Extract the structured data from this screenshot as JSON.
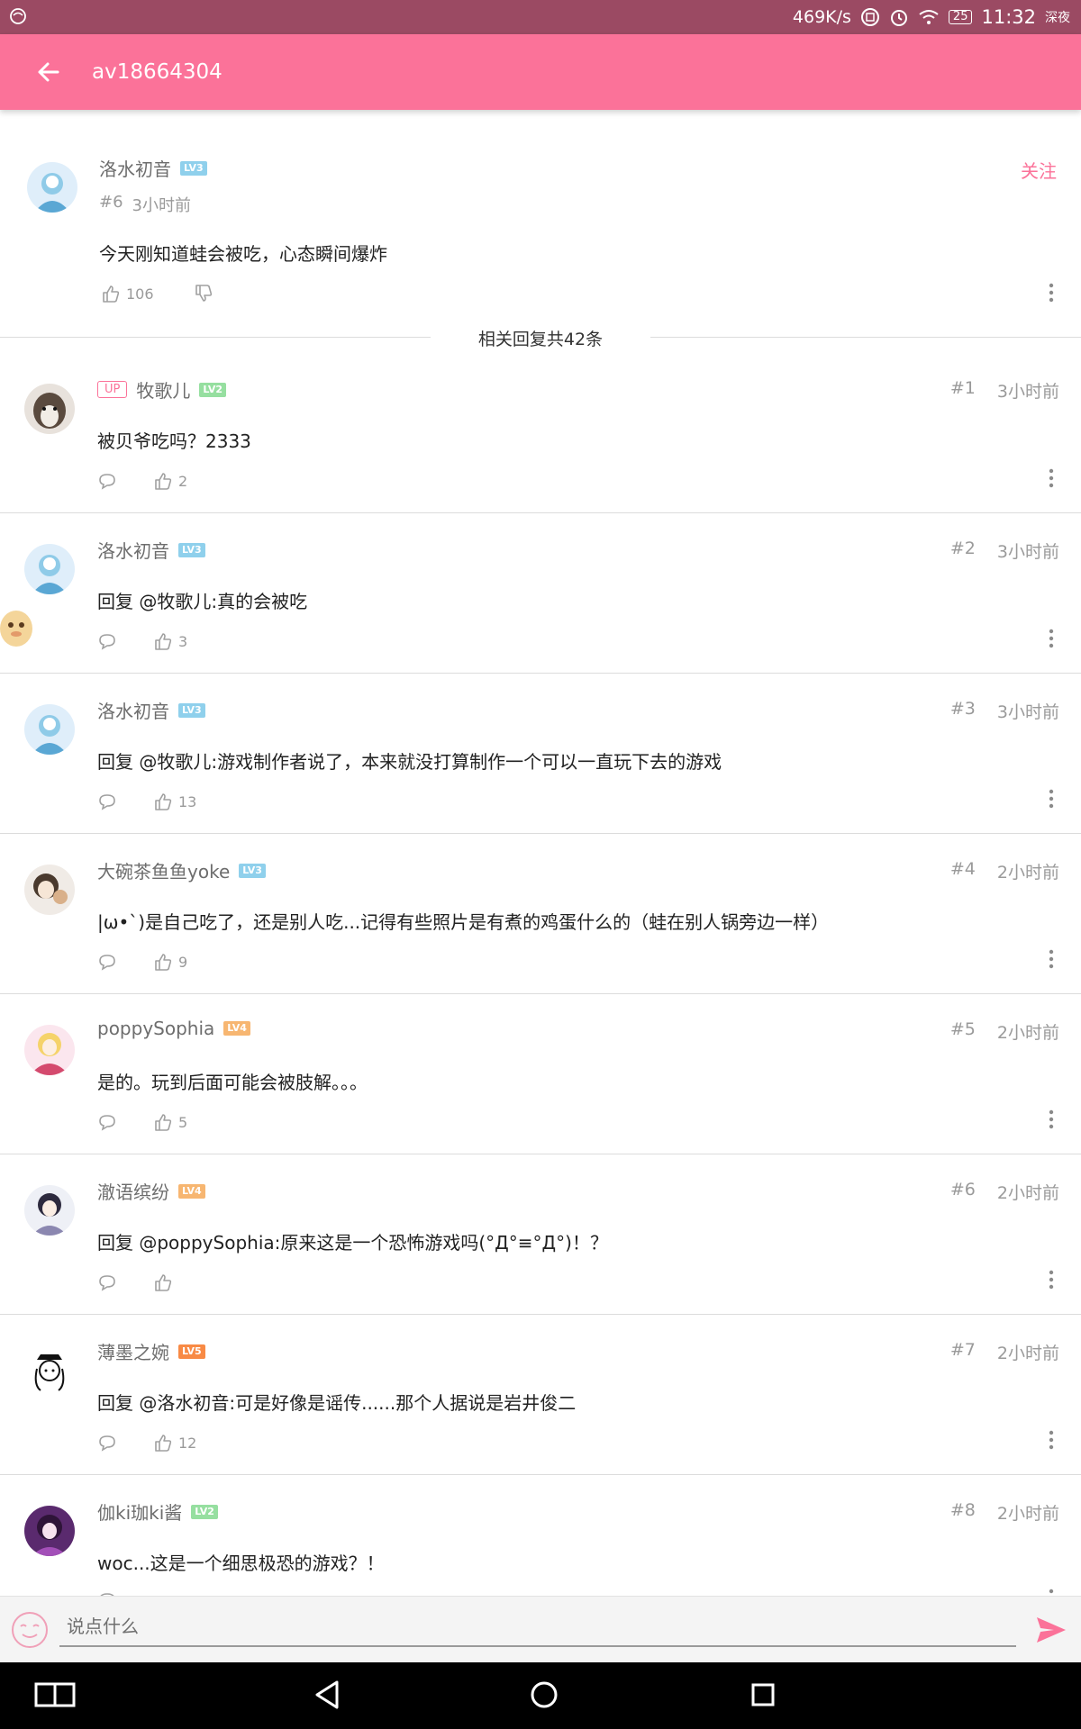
{
  "status_bar": {
    "speed": "469K/s",
    "battery": "25",
    "time": "11:32",
    "mode": "深夜"
  },
  "app_bar": {
    "title": "av18664304"
  },
  "main_comment": {
    "user": "洛水初音",
    "level": "LV3",
    "floor": "#6",
    "time": "3小时前",
    "text": "今天刚知道蛙会被吃，心态瞬间爆炸",
    "likes": "106",
    "follow_label": "关注"
  },
  "replies_header": "相关回复共42条",
  "replies": [
    {
      "user": "牧歌儿",
      "up_badge": "UP",
      "level": "LV2",
      "floor": "#1",
      "time": "3小时前",
      "text": "被贝爷吃吗？2333",
      "likes": "2"
    },
    {
      "user": "洛水初音",
      "level": "LV3",
      "floor": "#2",
      "time": "3小时前",
      "text": "回复 @牧歌儿:真的会被吃",
      "likes": "3"
    },
    {
      "user": "洛水初音",
      "level": "LV3",
      "floor": "#3",
      "time": "3小时前",
      "text": "回复 @牧歌儿:游戏制作者说了，本来就没打算制作一个可以一直玩下去的游戏",
      "likes": "13"
    },
    {
      "user": "大碗茶鱼鱼yoke",
      "level": "LV3",
      "floor": "#4",
      "time": "2小时前",
      "text": "|ω•`)是自己吃了，还是别人吃...记得有些照片是有煮的鸡蛋什么的（蛙在别人锅旁边一样）",
      "likes": "9"
    },
    {
      "user": "poppySophia",
      "level": "LV4",
      "floor": "#5",
      "time": "2小时前",
      "text": "是的。玩到后面可能会被肢解。。。",
      "likes": "5"
    },
    {
      "user": "澈语缤纷",
      "level": "LV4",
      "floor": "#6",
      "time": "2小时前",
      "text": "回复 @poppySophia:原来这是一个恐怖游戏吗(°Д°≡°Д°)！？",
      "likes": ""
    },
    {
      "user": "薄墨之婉",
      "level": "LV5",
      "floor": "#7",
      "time": "2小时前",
      "text": "回复 @洛水初音:可是好像是谣传......那个人据说是岩井俊二",
      "likes": "12"
    },
    {
      "user": "伽ki珈ki酱",
      "level": "LV2",
      "floor": "#8",
      "time": "2小时前",
      "text": "woc...这是一个细思极恐的游戏？！",
      "likes": ""
    }
  ],
  "input": {
    "placeholder": "说点什么"
  },
  "colors": {
    "accent": "#fb7299",
    "status_bar": "#9b4a63"
  }
}
